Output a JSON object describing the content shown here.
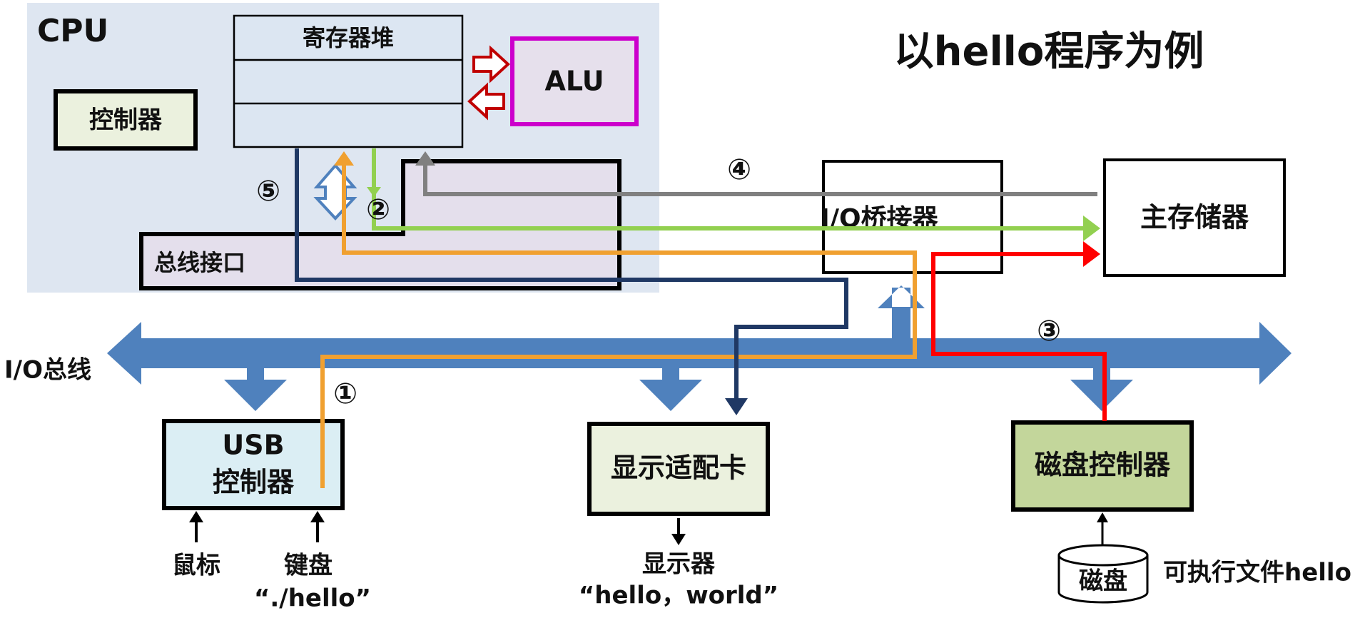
{
  "title": "以hello程序为例",
  "cpu": {
    "label": "CPU",
    "register_file": "寄存器堆",
    "alu": "ALU",
    "controller": "控制器",
    "bus_interface": "总线接口"
  },
  "io_bridge": "I/O桥接器",
  "main_memory": "主存储器",
  "io_bus": "I/O总线",
  "usb_controller": {
    "line1": "USB",
    "line2": "控制器"
  },
  "graphics_adapter": "显示适配卡",
  "disk_controller": "磁盘控制器",
  "mouse": "鼠标",
  "keyboard": "键盘",
  "keyboard_input": "“./hello”",
  "display": "显示器",
  "display_output": "“hello，world”",
  "disk": "磁盘",
  "executable": "可执行文件hello",
  "steps": [
    "①",
    "②",
    "③",
    "④",
    "⑤"
  ],
  "colors": {
    "cpu_bg": "#dee6f1",
    "bus_blue": "#4f81bd",
    "orange": "#f0a030",
    "green": "#92d050",
    "red": "#ff0000",
    "gray": "#808080",
    "navy": "#1f3864",
    "alu_border": "#cc00cc",
    "alu_fill": "#e6e0ec",
    "controller_fill": "#ebf1de",
    "usb_fill": "#dbeef4",
    "disk_ctrl_fill": "#c3d69b",
    "register_fill": "#dce6f2",
    "bus_if_fill": "#e4dfec",
    "arrow_dark_red": "#c00000"
  }
}
